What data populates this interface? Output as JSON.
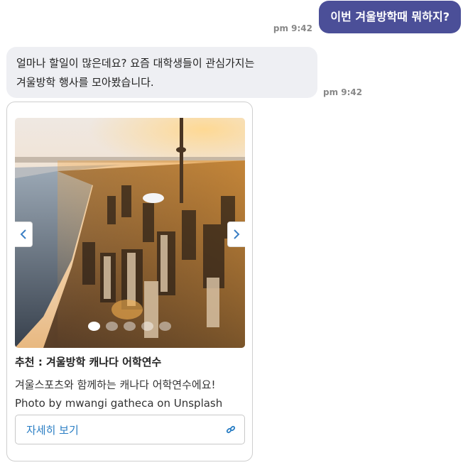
{
  "user_message": {
    "text": "이번 겨울방학때 뭐하지?",
    "time": "pm 9:42"
  },
  "bot_message": {
    "lines": [
      "얼마나 할일이 많은데요? 요즘 대학생들이 관심가지는",
      "겨울방학 행사를 모아봤습니다."
    ],
    "time": "pm 9:42"
  },
  "carousel": {
    "slide_count": 5,
    "active_index": 0,
    "card": {
      "title": "추천 : 겨울방학 캐나다 어학연수",
      "description": "겨울스포츠와 함께하는 캐나다 어학연수에요!",
      "credit": "Photo by mwangi gatheca on Unsplash",
      "button_label": "자세히 보기",
      "button_icon": "link-icon"
    }
  },
  "colors": {
    "user_bubble": "#4b4f98",
    "bot_bubble": "#eeeff3",
    "link": "#2a7ec4"
  }
}
